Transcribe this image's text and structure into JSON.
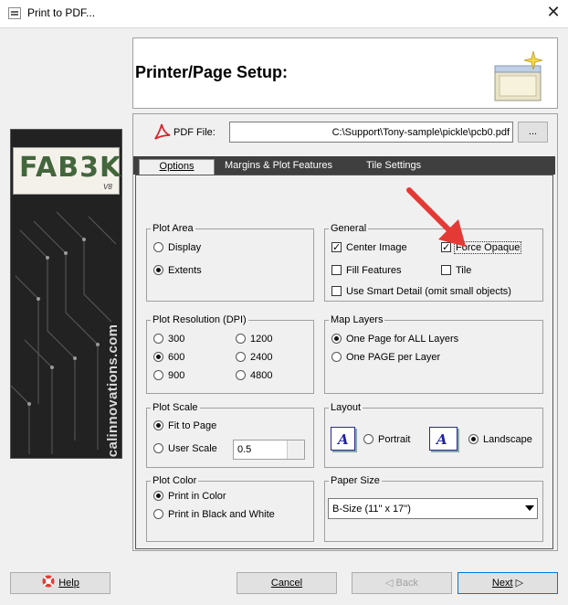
{
  "window": {
    "title": "Print to PDF...",
    "close_glyph": "✕"
  },
  "header": {
    "title": "Printer/Page Setup:"
  },
  "sidebar": {
    "logo": "FAB3K",
    "logo_version": "V8",
    "vertical_text": "numericalinnovations.com"
  },
  "pdf_file": {
    "label": "PDF File:",
    "value": "C:\\Support\\Tony-sample\\pickle\\pcb0.pdf",
    "browse_label": "..."
  },
  "tabs": [
    {
      "label": "Options",
      "active": true
    },
    {
      "label": "Margins & Plot Features",
      "active": false
    },
    {
      "label": "Tile Settings",
      "active": false
    }
  ],
  "plot_area": {
    "title": "Plot Area",
    "options": [
      "Display",
      "Extents"
    ],
    "selected": "Extents"
  },
  "general": {
    "title": "General",
    "center_image": "Center Image",
    "force_opaque": "Force Opaque",
    "fill_features": "Fill Features",
    "tile": "Tile",
    "smart_detail": "Use Smart Detail (omit small objects)",
    "checked_mark": "✓"
  },
  "plot_resolution": {
    "title": "Plot Resolution (DPI)",
    "options": [
      "300",
      "1200",
      "600",
      "2400",
      "900",
      "4800"
    ],
    "selected": "600"
  },
  "map_layers": {
    "title": "Map Layers",
    "options": [
      "One Page for ALL Layers",
      "One PAGE per Layer"
    ],
    "selected": "One Page for ALL Layers"
  },
  "plot_scale": {
    "title": "Plot Scale",
    "fit": "Fit to Page",
    "user": "User Scale",
    "user_value": "0.5",
    "selected": "Fit to Page"
  },
  "layout": {
    "title": "Layout",
    "icon_letter": "A",
    "portrait": "Portrait",
    "landscape": "Landscape",
    "selected": "Landscape"
  },
  "plot_color": {
    "title": "Plot Color",
    "options": [
      "Print in Color",
      "Print in Black and White"
    ],
    "selected": "Print in Color"
  },
  "paper_size": {
    "title": "Paper Size",
    "value": "B-Size (11\" x 17\")"
  },
  "buttons": {
    "help": "Help",
    "cancel": "Cancel",
    "back": "Back",
    "next": "Next"
  },
  "colors": {
    "annotation_arrow": "#e53935",
    "accent": "#0078d7"
  }
}
